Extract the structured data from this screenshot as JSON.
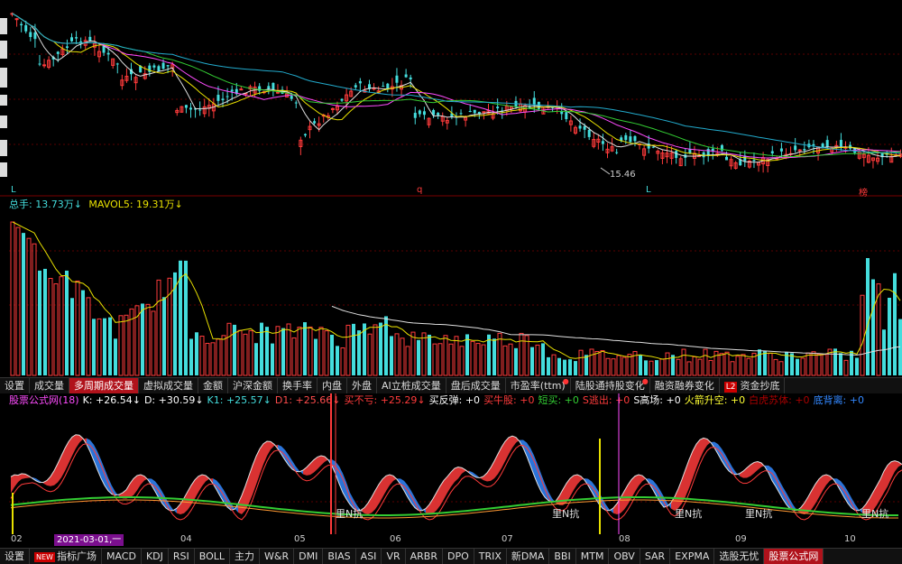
{
  "colors": {
    "up": "#ff3b3b",
    "down": "#44dddd",
    "white": "#e0e0e0",
    "yellow": "#e8e000",
    "magenta": "#ff4cff",
    "green": "#33cc33",
    "cyan": "#22aacc",
    "purple": "#9966ff",
    "orange": "#ff9933",
    "grid": "#5a0000"
  },
  "price_panel": {
    "low_label": "15.46",
    "markers": [
      "L",
      "q",
      "L",
      "榜"
    ]
  },
  "volume_legend": {
    "total": "总手: 13.73万↓",
    "mavol5": "MAVOL5: 19.31万↓"
  },
  "volume_tabs": [
    {
      "label": "设置",
      "active": false
    },
    {
      "label": "成交量",
      "active": false
    },
    {
      "label": "多周期成交量",
      "active": true
    },
    {
      "label": "虚拟成交量",
      "active": false
    },
    {
      "label": "金额",
      "active": false
    },
    {
      "label": "沪深金额",
      "active": false
    },
    {
      "label": "换手率",
      "active": false
    },
    {
      "label": "内盘",
      "active": false
    },
    {
      "label": "外盘",
      "active": false
    },
    {
      "label": "AI立桩成交量",
      "active": false
    },
    {
      "label": "盘后成交量",
      "active": false
    },
    {
      "label": "市盈率(ttm)",
      "active": false,
      "dot": true
    },
    {
      "label": "陆股通持股变化",
      "active": false,
      "dot": true
    },
    {
      "label": "融资融券变化",
      "active": false
    },
    {
      "label": "资金抄底",
      "active": false,
      "l2": "L2"
    }
  ],
  "indicator_legend": [
    {
      "text": "股票公式网(18)",
      "color": "#ff4cff"
    },
    {
      "text": "K: +26.54↓",
      "color": "#ffffff"
    },
    {
      "text": "D: +30.59↓",
      "color": "#ffffff"
    },
    {
      "text": "K1: +25.57↓",
      "color": "#44dddd"
    },
    {
      "text": "D1: +25.66↓",
      "color": "#ff4c4c"
    },
    {
      "text": "买不亏: +25.29↓",
      "color": "#ff3b3b"
    },
    {
      "text": "买反弹: +0",
      "color": "#ffffff"
    },
    {
      "text": "买牛股: +0",
      "color": "#ff3b3b"
    },
    {
      "text": "短买: +0",
      "color": "#33cc33"
    },
    {
      "text": "S逃出: +0",
      "color": "#ff3b3b"
    },
    {
      "text": "S高场: +0",
      "color": "#ffffff"
    },
    {
      "text": "火箭升空: +0",
      "color": "#ffff33"
    },
    {
      "text": "白虎苏体: +0",
      "color": "#aa0000"
    },
    {
      "text": "底背离: +0",
      "color": "#3388ff"
    }
  ],
  "indicator_labels": [
    "里N抗",
    "里N抗",
    "里N抗",
    "里N抗",
    "里N抗"
  ],
  "months": [
    "02",
    "04",
    "05",
    "06",
    "07",
    "08",
    "09",
    "10"
  ],
  "date_highlight": "2021-03-01,一",
  "bottom_tabs": [
    {
      "label": "设置",
      "active": false
    },
    {
      "label": "指标广场",
      "active": false,
      "badge": "NEW"
    },
    {
      "label": "MACD",
      "active": false
    },
    {
      "label": "KDJ",
      "active": false
    },
    {
      "label": "RSI",
      "active": false
    },
    {
      "label": "BOLL",
      "active": false
    },
    {
      "label": "主力",
      "active": false
    },
    {
      "label": "W&R",
      "active": false
    },
    {
      "label": "DMI",
      "active": false
    },
    {
      "label": "BIAS",
      "active": false
    },
    {
      "label": "ASI",
      "active": false
    },
    {
      "label": "VR",
      "active": false
    },
    {
      "label": "ARBR",
      "active": false
    },
    {
      "label": "DPO",
      "active": false
    },
    {
      "label": "TRIX",
      "active": false
    },
    {
      "label": "新DMA",
      "active": false
    },
    {
      "label": "BBI",
      "active": false
    },
    {
      "label": "MTM",
      "active": false
    },
    {
      "label": "OBV",
      "active": false
    },
    {
      "label": "SAR",
      "active": false
    },
    {
      "label": "EXPMA",
      "active": false
    },
    {
      "label": "选股无忧",
      "active": false
    },
    {
      "label": "股票公式网",
      "active": true
    }
  ]
}
